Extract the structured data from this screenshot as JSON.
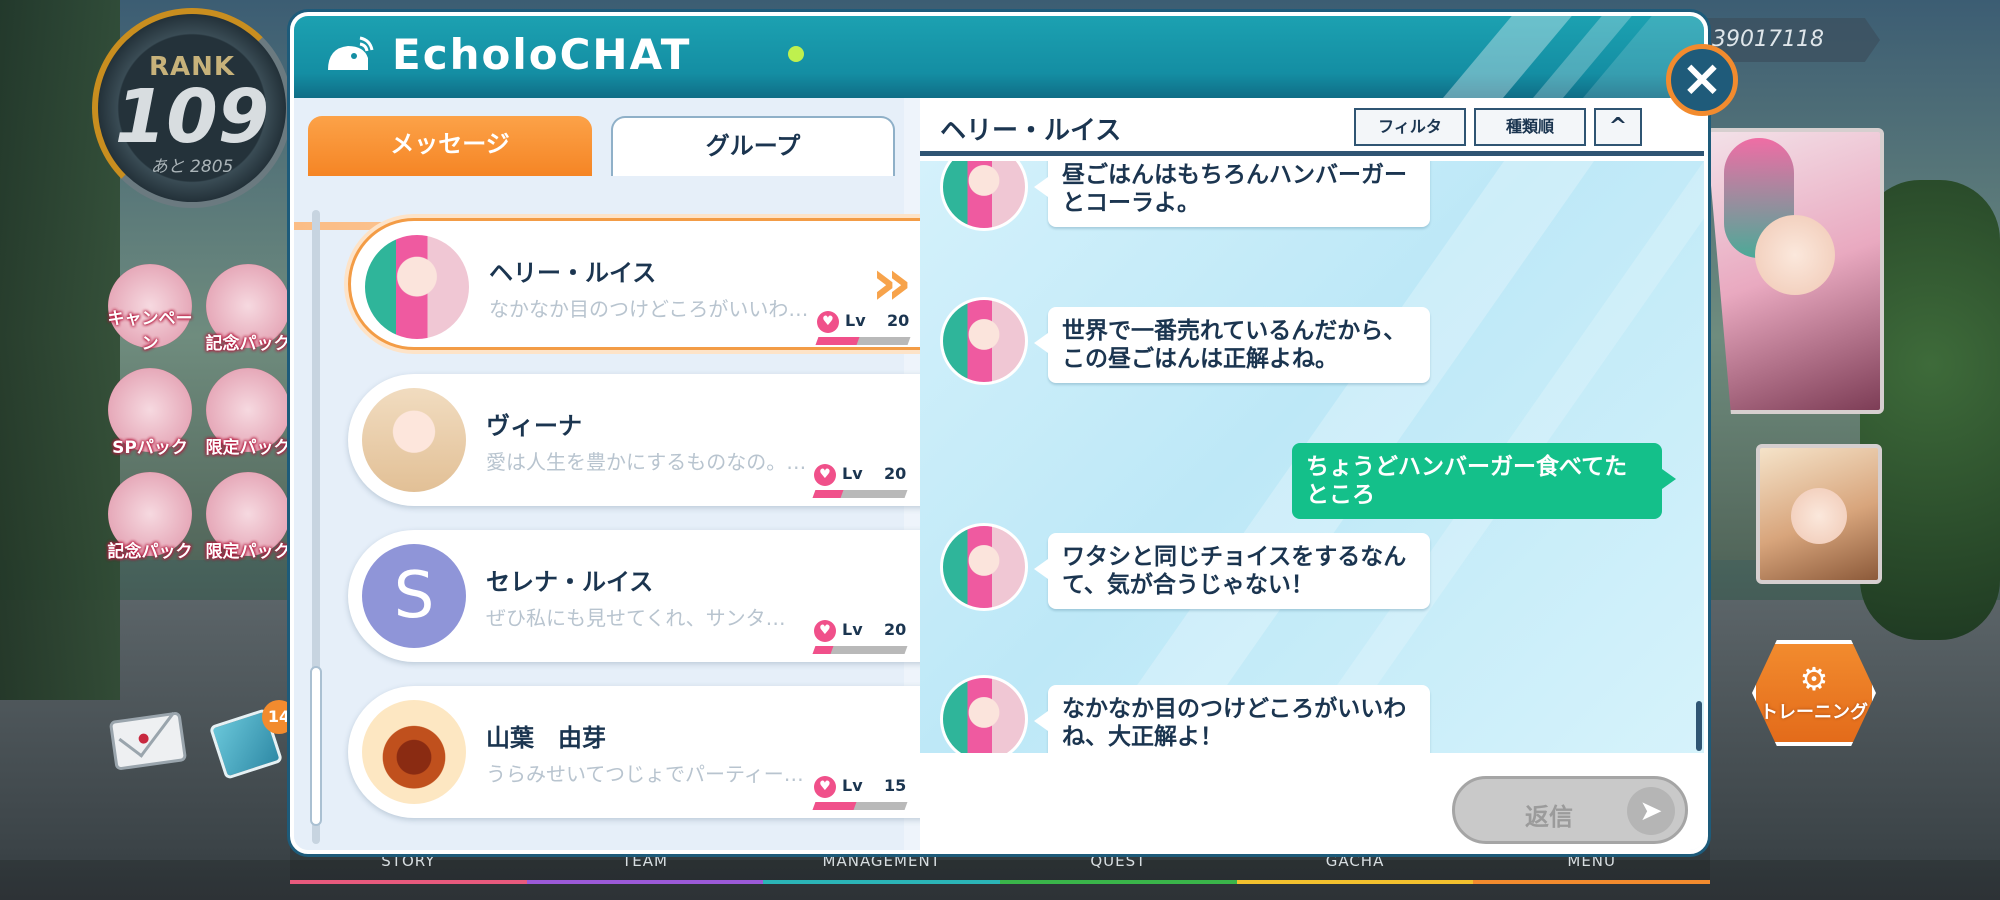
{
  "hud": {
    "rank_label": "RANK",
    "rank_value": "109",
    "rank_next": "あと 2805",
    "player_id": "39017118"
  },
  "side_buttons": [
    {
      "label": "キャンペーン"
    },
    {
      "label": "記念パック"
    },
    {
      "label": "SPパック"
    },
    {
      "label": "限定パック"
    },
    {
      "label": "記念パック"
    },
    {
      "label": "限定パック"
    }
  ],
  "flag_badge": "14",
  "training": {
    "label": "トレーニング",
    "icon": "bike-icon"
  },
  "bottom_nav": [
    "STORY",
    "TEAM",
    "MANAGEMENT",
    "QUEST",
    "GACHA",
    "MENU"
  ],
  "chat": {
    "app_title": "EcholoCHAT",
    "close_icon": "×",
    "tabs": {
      "messages": "メッセージ",
      "groups": "グループ"
    },
    "contacts": [
      {
        "name": "ヘリー・ルイス",
        "preview": "なかなか目のつけどころがいいわ…",
        "lv_label": "Lv",
        "level": "20",
        "affinity": 0.45,
        "avatar": "portrait",
        "selected": true
      },
      {
        "name": "ヴィーナ",
        "preview": "愛は人生を豊かにするものなの。…",
        "lv_label": "Lv",
        "level": "20",
        "affinity": 0.3,
        "avatar": "portrait"
      },
      {
        "name": "セレナ・ルイス",
        "preview": "ぜひ私にも見せてくれ、サンタ…",
        "lv_label": "Lv",
        "level": "20",
        "affinity": 0.2,
        "avatar": "S"
      },
      {
        "name": "山葉　由芽",
        "preview": "うらみせいてつじょでパーティー…",
        "lv_label": "Lv",
        "level": "15",
        "affinity": 0.45,
        "avatar": "food"
      }
    ],
    "thread": {
      "title": "ヘリー・ルイス",
      "filter_label": "フィルタ",
      "sort_label": "種類順",
      "collapse_icon": "^",
      "messages": [
        {
          "from": "ヘリー・ルイス",
          "text": "昼ごはんはもちろんハンバーガーとコーラよ。"
        },
        {
          "from": "ヘリー・ルイス",
          "text": "世界で一番売れているんだから、この昼ごはんは正解よね。"
        },
        {
          "from": "self",
          "text": "ちょうどハンバーガー食べてたところ"
        },
        {
          "from": "ヘリー・ルイス",
          "text": "ワタシと同じチョイスをするなんて、気が合うじゃない！"
        },
        {
          "from": "ヘリー・ルイス",
          "text": "なかなか目のつけどころがいいわね、大正解よ！"
        }
      ],
      "reply_label": "返信"
    }
  },
  "colors": {
    "header_teal": "#148ea3",
    "tab_orange": "#f58525",
    "self_bubble_green": "#14c08a",
    "text_navy": "#1b3550",
    "heart_pink": "#f0508a"
  }
}
